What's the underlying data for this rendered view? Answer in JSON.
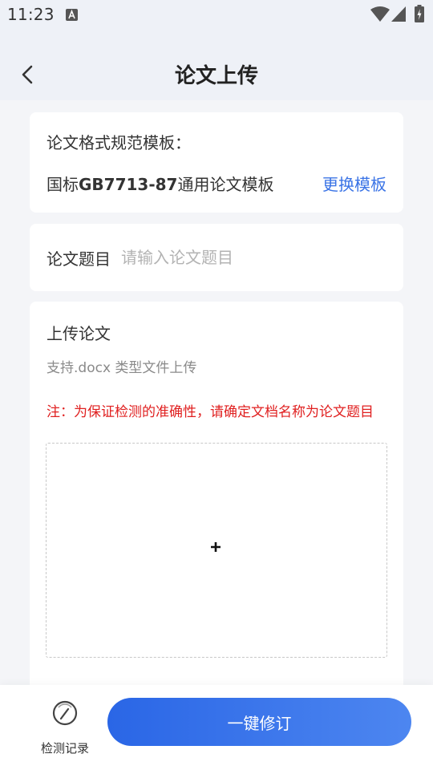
{
  "status_bar": {
    "time": "11:23",
    "notification_icon": "a-box-icon",
    "wifi_icon": "wifi-icon",
    "signal_icon": "cellular-signal-icon",
    "battery_icon": "battery-charging-icon"
  },
  "nav": {
    "back_icon": "chevron-left-icon",
    "title": "论文上传"
  },
  "template_card": {
    "heading": "论文格式规范模板：",
    "name_prefix": "国标",
    "name_bold": "GB7713-87",
    "name_suffix": "通用论文模板",
    "change_label": "更换模板"
  },
  "title_card": {
    "label": "论文题目",
    "input_value": "",
    "input_placeholder": "请输入论文题目"
  },
  "upload_card": {
    "heading": "上传论文",
    "support_text": "支持.docx 类型文件上传",
    "note": "注：为保证检测的准确性，请确定文档名称为论文题目",
    "add_icon": "plus-icon"
  },
  "bottom_bar": {
    "history_label": "检测记录",
    "history_icon": "gauge-icon",
    "primary_button": "一键修订"
  },
  "colors": {
    "accent": "#3b74e6",
    "warning": "#e02020",
    "button_gradient_start": "#2a66e6",
    "button_gradient_end": "#4d86f0"
  }
}
